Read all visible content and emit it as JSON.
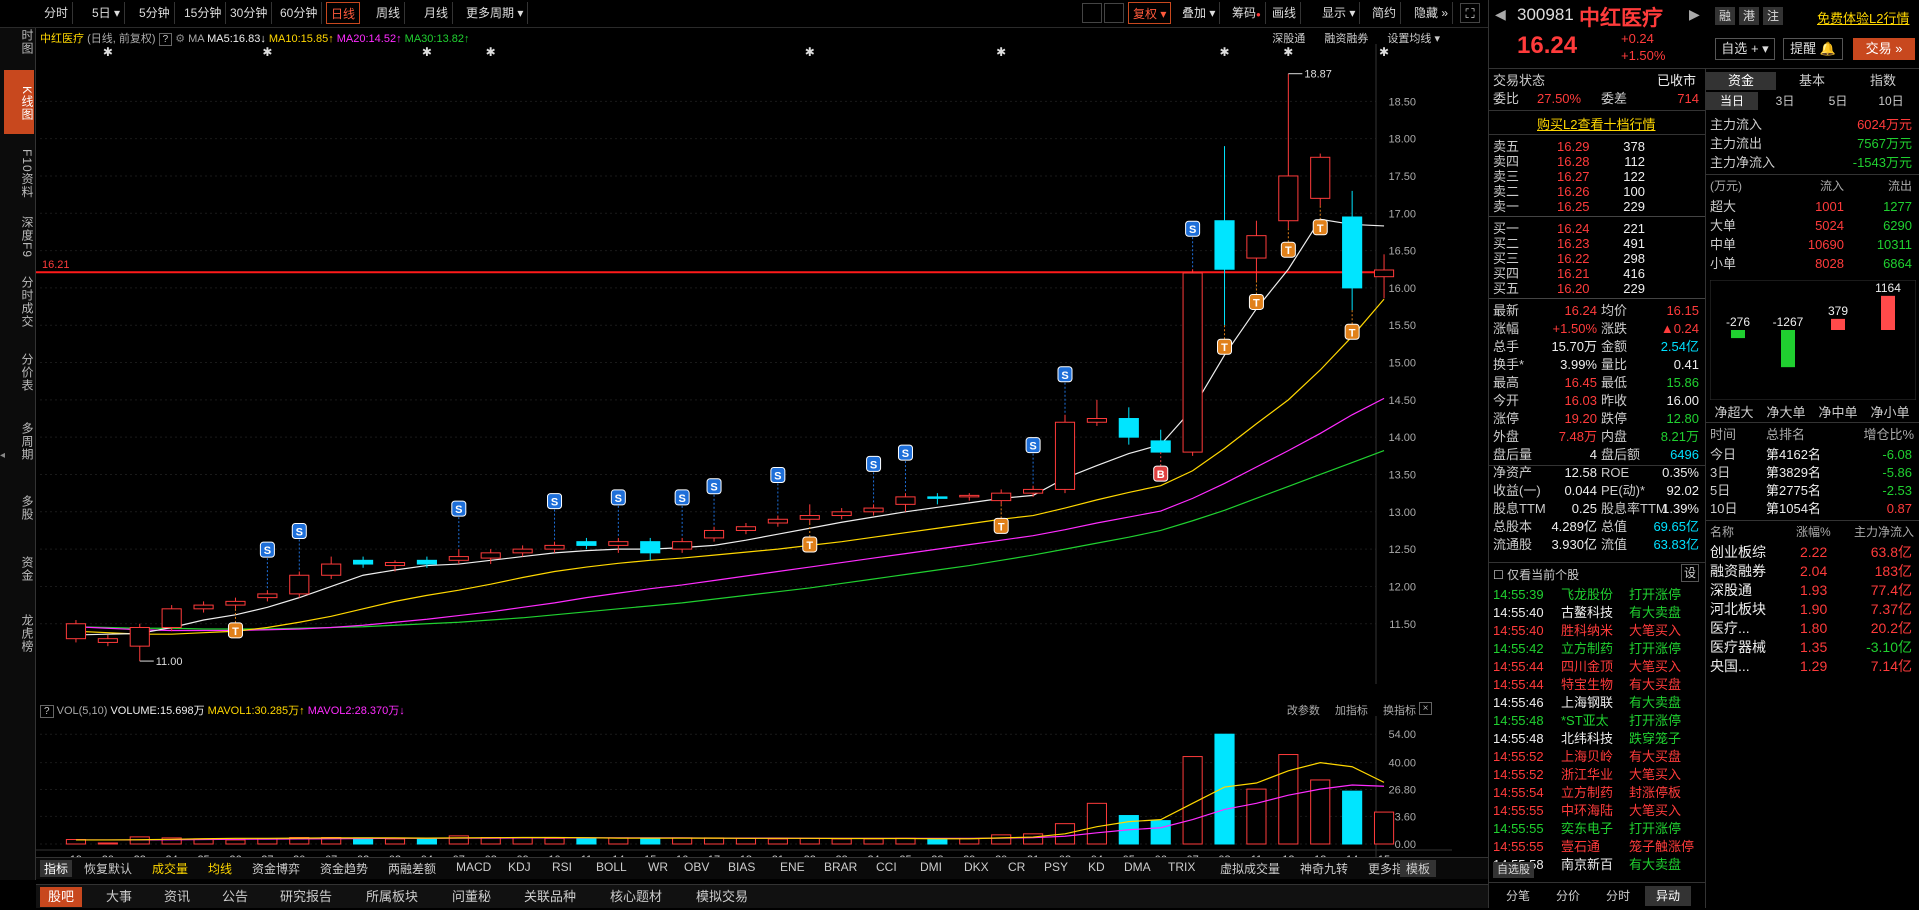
{
  "left_rail": [
    "分时图",
    "K线图",
    "F10资料",
    "深度F9",
    "分时成交",
    "分价表",
    "多周期",
    "多股",
    "资金",
    "龙虎榜"
  ],
  "toolbar": {
    "periods": [
      "分时",
      "5日",
      "5分钟",
      "15分钟",
      "30分钟",
      "60分钟",
      "日线",
      "周线",
      "月线",
      "更多周期"
    ],
    "active": "日线",
    "right": [
      "复权",
      "叠加",
      "筹码",
      "画线",
      "显示",
      "简约",
      "隐藏"
    ],
    "plus": "+",
    "minus": "−"
  },
  "chart_info": {
    "name": "中红医疗",
    "mode": "(日线, 前复权)",
    "ma_label": "MA",
    "ma5": "MA5:16.83",
    "ma10": "MA10:15.85",
    "ma20": "MA20:14.52",
    "ma30": "MA30:13.82",
    "right_links": [
      "深股通",
      "融资融券",
      "设置均线"
    ],
    "price_line": "16.21",
    "hi_label": "18.87",
    "lo_label": "11.00"
  },
  "chart_data": {
    "type": "candlestick",
    "ylim": [
      10.8,
      19.0
    ],
    "yticks": [
      11.5,
      12.0,
      12.5,
      13.0,
      13.5,
      14.0,
      14.5,
      15.0,
      15.5,
      16.0,
      16.5,
      17.0,
      17.5,
      18.0,
      18.5
    ],
    "x": [
      "19",
      "20",
      "23",
      "24",
      "25",
      "26",
      "27",
      "30",
      "07",
      "02",
      "03",
      "04",
      "07",
      "08",
      "09",
      "10",
      "11",
      "14",
      "15",
      "16",
      "17",
      "18",
      "21",
      "22",
      "23",
      "24",
      "25",
      "28",
      "29",
      "30",
      "31",
      "08",
      "04",
      "05",
      "06",
      "07",
      "08",
      "11",
      "12",
      "13",
      "14",
      "15"
    ],
    "candles": [
      [
        11.3,
        11.55,
        11.25,
        11.5
      ],
      [
        11.25,
        11.35,
        11.2,
        11.3
      ],
      [
        11.2,
        11.5,
        11.0,
        11.45
      ],
      [
        11.45,
        11.75,
        11.4,
        11.7
      ],
      [
        11.7,
        11.8,
        11.65,
        11.75
      ],
      [
        11.75,
        11.85,
        11.7,
        11.8
      ],
      [
        11.85,
        11.95,
        11.8,
        11.9
      ],
      [
        11.9,
        12.2,
        11.85,
        12.15
      ],
      [
        12.15,
        12.4,
        12.1,
        12.3
      ],
      [
        12.35,
        12.4,
        12.25,
        12.3
      ],
      [
        12.28,
        12.35,
        12.2,
        12.32
      ],
      [
        12.35,
        12.4,
        12.25,
        12.3
      ],
      [
        12.35,
        12.5,
        12.3,
        12.4
      ],
      [
        12.38,
        12.5,
        12.3,
        12.45
      ],
      [
        12.45,
        12.55,
        12.4,
        12.5
      ],
      [
        12.5,
        12.6,
        12.45,
        12.55
      ],
      [
        12.6,
        12.65,
        12.5,
        12.55
      ],
      [
        12.55,
        12.65,
        12.45,
        12.6
      ],
      [
        12.6,
        12.65,
        12.35,
        12.45
      ],
      [
        12.5,
        12.65,
        12.45,
        12.6
      ],
      [
        12.65,
        12.8,
        12.6,
        12.75
      ],
      [
        12.75,
        12.85,
        12.7,
        12.8
      ],
      [
        12.85,
        12.95,
        12.8,
        12.9
      ],
      [
        12.9,
        13.1,
        12.85,
        12.95
      ],
      [
        12.95,
        13.05,
        12.9,
        13.0
      ],
      [
        13.0,
        13.1,
        12.95,
        13.05
      ],
      [
        13.1,
        13.25,
        13.0,
        13.2
      ],
      [
        13.2,
        13.25,
        13.1,
        13.18
      ],
      [
        13.2,
        13.25,
        13.15,
        13.22
      ],
      [
        13.15,
        13.3,
        13.1,
        13.25
      ],
      [
        13.25,
        13.35,
        13.2,
        13.3
      ],
      [
        13.3,
        14.3,
        13.25,
        14.2
      ],
      [
        14.2,
        14.5,
        14.15,
        14.25
      ],
      [
        14.25,
        14.4,
        13.9,
        14.0
      ],
      [
        13.95,
        14.1,
        13.8,
        13.8
      ],
      [
        13.8,
        16.25,
        13.75,
        16.2
      ],
      [
        16.9,
        17.9,
        15.5,
        16.25
      ],
      [
        16.4,
        16.9,
        16.1,
        16.7
      ],
      [
        16.9,
        18.87,
        16.8,
        17.5
      ],
      [
        17.2,
        17.8,
        17.1,
        17.75
      ],
      [
        16.95,
        17.3,
        15.7,
        16.0
      ],
      [
        16.15,
        16.45,
        15.86,
        16.24
      ]
    ],
    "ma5": [
      11.35,
      11.36,
      11.37,
      11.45,
      11.55,
      11.62,
      11.72,
      11.85,
      12.0,
      12.15,
      12.22,
      12.28,
      12.3,
      12.35,
      12.4,
      12.45,
      12.48,
      12.5,
      12.5,
      12.52,
      12.55,
      12.62,
      12.7,
      12.78,
      12.86,
      12.93,
      13.0,
      13.06,
      13.12,
      13.18,
      13.22,
      13.45,
      13.62,
      13.78,
      13.9,
      14.38,
      15.1,
      15.72,
      16.25,
      16.92,
      16.85,
      16.83
    ],
    "ma10": [
      11.4,
      11.38,
      11.36,
      11.36,
      11.38,
      11.4,
      11.45,
      11.52,
      11.6,
      11.7,
      11.8,
      11.88,
      11.95,
      12.03,
      12.12,
      12.2,
      12.26,
      12.31,
      12.35,
      12.38,
      12.42,
      12.46,
      12.5,
      12.55,
      12.6,
      12.66,
      12.72,
      12.78,
      12.84,
      12.9,
      12.95,
      13.05,
      13.16,
      13.26,
      13.35,
      13.55,
      13.85,
      14.18,
      14.5,
      14.9,
      15.35,
      15.85
    ],
    "ma20": [
      11.46,
      11.44,
      11.42,
      11.41,
      11.41,
      11.41,
      11.42,
      11.43,
      11.45,
      11.48,
      11.52,
      11.56,
      11.61,
      11.66,
      11.72,
      11.78,
      11.85,
      11.91,
      11.97,
      12.02,
      12.08,
      12.14,
      12.2,
      12.26,
      12.32,
      12.38,
      12.44,
      12.5,
      12.56,
      12.62,
      12.68,
      12.76,
      12.85,
      12.93,
      13.01,
      13.18,
      13.38,
      13.6,
      13.82,
      14.05,
      14.3,
      14.52
    ],
    "ma30": [
      11.46,
      11.45,
      11.44,
      11.44,
      11.43,
      11.43,
      11.43,
      11.44,
      11.45,
      11.46,
      11.48,
      11.5,
      11.52,
      11.55,
      11.58,
      11.62,
      11.66,
      11.7,
      11.74,
      11.78,
      11.83,
      11.88,
      11.93,
      11.98,
      12.04,
      12.1,
      12.16,
      12.22,
      12.28,
      12.35,
      12.42,
      12.5,
      12.58,
      12.66,
      12.75,
      12.88,
      13.02,
      13.18,
      13.34,
      13.5,
      13.66,
      13.82
    ],
    "signals": [
      {
        "i": 6,
        "type": "S"
      },
      {
        "i": 7,
        "type": "S"
      },
      {
        "i": 12,
        "type": "S"
      },
      {
        "i": 15,
        "type": "S"
      },
      {
        "i": 17,
        "type": "S"
      },
      {
        "i": 19,
        "type": "S"
      },
      {
        "i": 20,
        "type": "S"
      },
      {
        "i": 22,
        "type": "S"
      },
      {
        "i": 25,
        "type": "S"
      },
      {
        "i": 26,
        "type": "S"
      },
      {
        "i": 30,
        "type": "S"
      },
      {
        "i": 31,
        "type": "S"
      },
      {
        "i": 35,
        "type": "S"
      },
      {
        "i": 5,
        "type": "T"
      },
      {
        "i": 23,
        "type": "T"
      },
      {
        "i": 29,
        "type": "T"
      },
      {
        "i": 36,
        "type": "T"
      },
      {
        "i": 37,
        "type": "T"
      },
      {
        "i": 38,
        "type": "T"
      },
      {
        "i": 39,
        "type": "T"
      },
      {
        "i": 40,
        "type": "T"
      },
      {
        "i": 34,
        "type": "B"
      }
    ],
    "stars": [
      1,
      6,
      11,
      13,
      23,
      29,
      36,
      38,
      41
    ],
    "volume": {
      "label": "VOL(5,10)",
      "volume": "VOLUME:15.698万",
      "mavol1": "MAVOL1:30.285万",
      "mavol2": "MAVOL2:28.370万",
      "ylim": [
        0,
        60
      ],
      "yticks": [
        0.0,
        13.6,
        26.8,
        40.0,
        54.0
      ],
      "values": [
        2.2,
        0.5,
        3.5,
        3.0,
        2.5,
        2.0,
        2.5,
        3.2,
        3.2,
        3.0,
        2.5,
        2.6,
        4.0,
        3.2,
        3.0,
        2.8,
        2.5,
        3.0,
        2.6,
        3.0,
        3.0,
        2.8,
        2.5,
        2.8,
        2.5,
        2.5,
        2.8,
        2.5,
        2.6,
        4.5,
        5.0,
        10.0,
        20.0,
        14.0,
        11.5,
        43.0,
        54.0,
        27.0,
        44.0,
        31.5,
        26.0,
        15.7
      ],
      "mavol1_line": [
        2,
        2,
        2.1,
        2.3,
        2.6,
        2.8,
        2.8,
        2.9,
        3.0,
        3.0,
        3.0,
        2.9,
        3.0,
        3.1,
        3.2,
        3.2,
        3.1,
        2.9,
        2.9,
        2.9,
        2.9,
        2.8,
        2.8,
        2.8,
        2.7,
        2.7,
        2.7,
        2.6,
        2.6,
        3.0,
        3.4,
        5.0,
        8.5,
        11.0,
        12.0,
        20.0,
        28.0,
        30.0,
        36.0,
        40.0,
        38.0,
        30.3
      ],
      "mavol2_line": [
        2,
        2,
        2,
        2.1,
        2.2,
        2.3,
        2.4,
        2.5,
        2.6,
        2.7,
        2.8,
        2.8,
        2.9,
        2.9,
        3.0,
        3.0,
        3.0,
        3.0,
        3.0,
        3.0,
        2.9,
        2.9,
        2.9,
        2.8,
        2.8,
        2.8,
        2.8,
        2.8,
        2.8,
        2.9,
        3.1,
        3.8,
        5.5,
        7.0,
        8.0,
        12.0,
        17.0,
        20.0,
        24.0,
        27.0,
        29.0,
        28.4
      ]
    },
    "vol_links": [
      "改参数",
      "加指标",
      "换指标"
    ]
  },
  "indicators": [
    "指标",
    "恢复默认",
    "成交量",
    "均线",
    "资金博弈",
    "资金趋势",
    "两融差额",
    "MACD",
    "KDJ",
    "RSI",
    "BOLL",
    "WR",
    "OBV",
    "BIAS",
    "ENE",
    "BRAR",
    "CCI",
    "DMI",
    "DKX",
    "CR",
    "PSY",
    "KD",
    "DMA",
    "TRIX",
    "虚拟成交量",
    "神奇九转",
    "更多指标",
    "模板"
  ],
  "bottom_tabs": [
    "股吧",
    "大事",
    "资讯",
    "公告",
    "研究报告",
    "所属板块",
    "问董秘",
    "关联品种",
    "核心题材",
    "模拟交易"
  ],
  "stock": {
    "code": "300981",
    "name": "中红医疗",
    "tags": [
      "融",
      "港",
      "注"
    ],
    "promo": "免费体验L2行情",
    "price": "16.24",
    "chg": "+0.24",
    "pct": "+1.50%",
    "btn_watch": "自选",
    "btn_alert": "提醒",
    "btn_trade": "交易",
    "status_label": "交易状态",
    "status": "已收市",
    "wb_label": "委比",
    "wb": "27.50%",
    "wc_label": "委差",
    "wc": "714",
    "l2": "购买L2查看十档行情",
    "asks": [
      [
        "卖五",
        "16.29",
        "378"
      ],
      [
        "卖四",
        "16.28",
        "112"
      ],
      [
        "卖三",
        "16.27",
        "122"
      ],
      [
        "卖二",
        "16.26",
        "100"
      ],
      [
        "卖一",
        "16.25",
        "229"
      ]
    ],
    "bids": [
      [
        "买一",
        "16.24",
        "221"
      ],
      [
        "买二",
        "16.23",
        "491"
      ],
      [
        "买三",
        "16.22",
        "298"
      ],
      [
        "买四",
        "16.21",
        "416"
      ],
      [
        "买五",
        "16.20",
        "229"
      ]
    ],
    "stats": [
      [
        "最新",
        "16.24",
        "均价",
        "16.15"
      ],
      [
        "涨幅",
        "+1.50%",
        "涨跌",
        "▲0.24"
      ],
      [
        "总手",
        "15.70万",
        "金额",
        "2.54亿"
      ],
      [
        "换手*",
        "3.99%",
        "量比",
        "0.41"
      ],
      [
        "最高",
        "16.45",
        "最低",
        "15.86"
      ],
      [
        "今开",
        "16.03",
        "昨收",
        "16.00"
      ],
      [
        "涨停",
        "19.20",
        "跌停",
        "12.80"
      ],
      [
        "外盘",
        "7.48万",
        "内盘",
        "8.21万"
      ],
      [
        "盘后量",
        "4",
        "盘后额",
        "6496"
      ],
      [
        "净资产",
        "12.58",
        "ROE",
        "0.35%"
      ],
      [
        "收益(一)",
        "0.044",
        "PE(动)*",
        "92.02"
      ],
      [
        "股息TTM",
        "0.25",
        "股息率TTM",
        "1.39%"
      ],
      [
        "总股本",
        "4.289亿",
        "总值",
        "69.65亿"
      ],
      [
        "流通股",
        "3.930亿",
        "流值",
        "63.83亿"
      ]
    ],
    "only_current": "仅看当前个股",
    "settings": "设",
    "feed": [
      [
        "14:55:39",
        "飞龙股份",
        "打开涨停"
      ],
      [
        "14:55:40",
        "古鳌科技",
        "有大卖盘"
      ],
      [
        "14:55:40",
        "胜科纳米",
        "大笔买入"
      ],
      [
        "14:55:42",
        "立方制药",
        "打开涨停"
      ],
      [
        "14:55:44",
        "四川金顶",
        "大笔买入"
      ],
      [
        "14:55:44",
        "特宝生物",
        "有大买盘"
      ],
      [
        "14:55:46",
        "上海钢联",
        "有大卖盘"
      ],
      [
        "14:55:48",
        "*ST亚太",
        "打开涨停"
      ],
      [
        "14:55:48",
        "北纬科技",
        "跌穿笼子"
      ],
      [
        "14:55:52",
        "上海贝岭",
        "有大买盘"
      ],
      [
        "14:55:52",
        "浙江华业",
        "大笔买入"
      ],
      [
        "14:55:54",
        "立方制药",
        "封涨停板"
      ],
      [
        "14:55:55",
        "中环海陆",
        "大笔买入"
      ],
      [
        "14:55:55",
        "奕东电子",
        "打开涨停"
      ],
      [
        "14:55:55",
        "壹石通",
        "笼子触涨停"
      ],
      [
        "14:55:58",
        "南京新百",
        "有大卖盘"
      ]
    ],
    "feed_tab": "自选股",
    "feed_tabs": [
      "分笔",
      "分价",
      "分时",
      "异动"
    ],
    "right_tabs": [
      "资金",
      "基本",
      "指数"
    ],
    "period_tabs": [
      "当日",
      "3日",
      "5日",
      "10日"
    ],
    "flows": [
      [
        "主力流入",
        "6024万元"
      ],
      [
        "主力流出",
        "7567万元"
      ],
      [
        "主力净流入",
        "-1543万元"
      ]
    ],
    "flow_head": [
      "(万元)",
      "流入",
      "流出"
    ],
    "flow_rows": [
      [
        "超大",
        "1001",
        "1277"
      ],
      [
        "大单",
        "5024",
        "6290"
      ],
      [
        "中单",
        "10690",
        "10311"
      ],
      [
        "小单",
        "8028",
        "6864"
      ]
    ],
    "net": {
      "labels": [
        "净超大",
        "净大单",
        "净中单",
        "净小单"
      ],
      "values": [
        -276,
        -1267,
        379,
        1164
      ]
    },
    "rank_head": [
      "时间",
      "总排名",
      "增仓比%"
    ],
    "ranks": [
      [
        "今日",
        "第4162名",
        "-6.08"
      ],
      [
        "3日",
        "第3829名",
        "-5.86"
      ],
      [
        "5日",
        "第2775名",
        "-2.53"
      ],
      [
        "10日",
        "第1054名",
        "0.87"
      ]
    ],
    "sector_head": [
      "名称",
      "涨幅%",
      "主力净流入"
    ],
    "sectors": [
      [
        "创业板综",
        "2.22",
        "63.8亿"
      ],
      [
        "融资融券",
        "2.04",
        "183亿"
      ],
      [
        "深股通",
        "1.93",
        "77.4亿"
      ],
      [
        "河北板块",
        "1.90",
        "7.37亿"
      ],
      [
        "医疗...",
        "1.80",
        "20.2亿"
      ],
      [
        "医疗器械",
        "1.35",
        "-3.10亿"
      ],
      [
        "央国...",
        "1.29",
        "7.14亿"
      ]
    ]
  }
}
